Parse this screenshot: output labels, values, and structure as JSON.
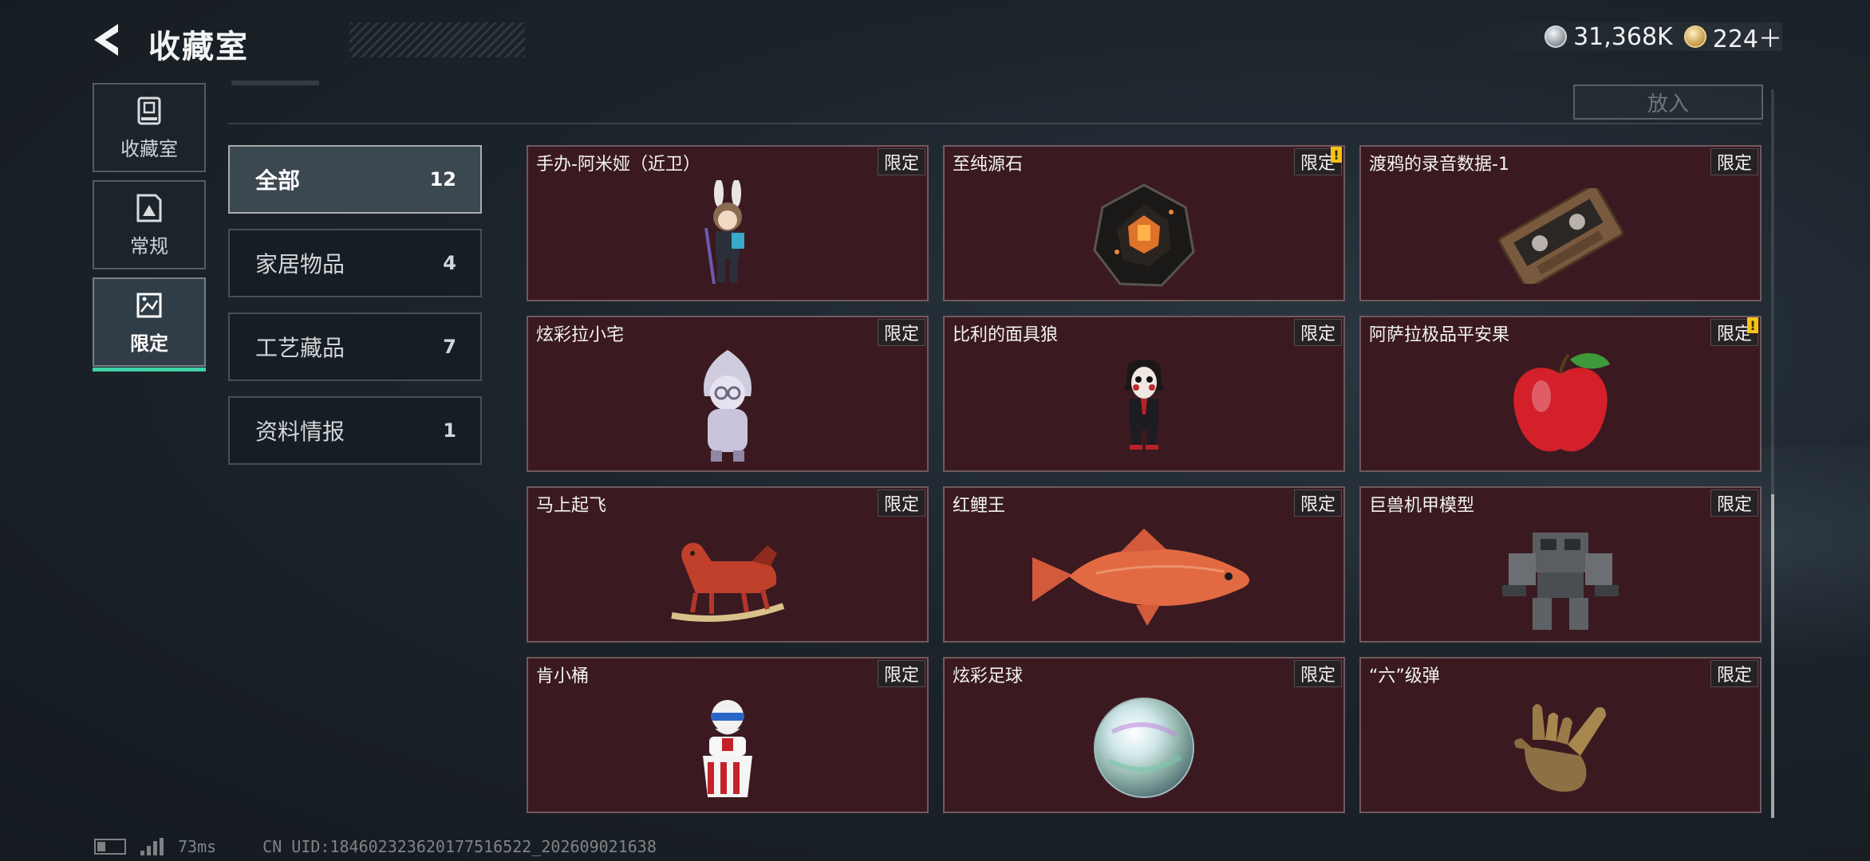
{
  "header": {
    "title": "收藏室",
    "currency": [
      {
        "icon": "silver-coin-icon",
        "value": "31,368K"
      },
      {
        "icon": "gold-coin-icon",
        "value": "224＋"
      }
    ]
  },
  "side_tabs": [
    {
      "label": "收藏室",
      "icon": "collection-room-icon",
      "active": false
    },
    {
      "label": "常规",
      "icon": "regular-photo-icon",
      "active": false
    },
    {
      "label": "限定",
      "icon": "limited-photo-icon",
      "active": true
    }
  ],
  "top_bar": {
    "place_button_label": "放入"
  },
  "categories": [
    {
      "name": "全部",
      "count": "12",
      "active": true
    },
    {
      "name": "家居物品",
      "count": "4",
      "active": false
    },
    {
      "name": "工艺藏品",
      "count": "7",
      "active": false
    },
    {
      "name": "资料情报",
      "count": "1",
      "active": false
    }
  ],
  "items": [
    {
      "name": "手办-阿米娅（近卫）",
      "badge": "限定",
      "alert": false,
      "icon": "figure-amiya-icon"
    },
    {
      "name": "至纯源石",
      "badge": "限定",
      "alert": true,
      "icon": "originium-crystal-icon"
    },
    {
      "name": "渡鸦的录音数据-1",
      "badge": "限定",
      "alert": false,
      "icon": "cassette-tape-icon"
    },
    {
      "name": "炫彩拉小宅",
      "badge": "限定",
      "alert": false,
      "icon": "hooded-figure-icon"
    },
    {
      "name": "比利的面具狼",
      "badge": "限定",
      "alert": false,
      "icon": "puppet-doll-icon"
    },
    {
      "name": "阿萨拉极品平安果",
      "badge": "限定",
      "alert": true,
      "icon": "red-apple-icon"
    },
    {
      "name": "马上起飞",
      "badge": "限定",
      "alert": false,
      "icon": "rocking-horse-icon"
    },
    {
      "name": "红鲤王",
      "badge": "限定",
      "alert": false,
      "icon": "red-carp-icon"
    },
    {
      "name": "巨兽机甲模型",
      "badge": "限定",
      "alert": false,
      "icon": "mech-model-icon"
    },
    {
      "name": "肯小桶",
      "badge": "限定",
      "alert": false,
      "icon": "colonel-bucket-icon"
    },
    {
      "name": "炫彩足球",
      "badge": "限定",
      "alert": false,
      "icon": "iridescent-ball-icon"
    },
    {
      "name": "“六”级弹",
      "badge": "限定",
      "alert": false,
      "icon": "bronze-hand-icon"
    }
  ],
  "alert_mark": "!",
  "status_bar": {
    "ping": "73ms",
    "uid": "CN UID:18460232362017751652​2_202609021638"
  }
}
